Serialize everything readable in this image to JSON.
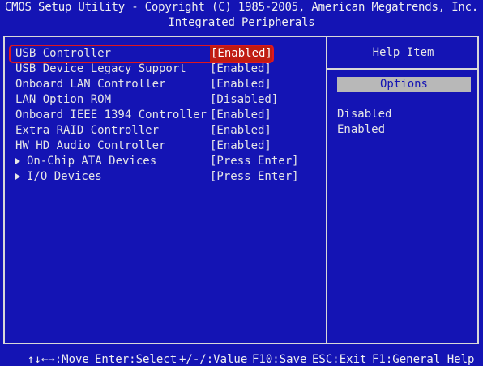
{
  "header": {
    "line1": "CMOS Setup Utility - Copyright (C) 1985-2005, American Megatrends, Inc.",
    "line2": "Integrated Peripherals"
  },
  "settings": [
    {
      "label": "USB Controller",
      "value": "[Enabled]",
      "selected": true
    },
    {
      "label": "USB Device Legacy Support",
      "value": "[Enabled]"
    },
    {
      "label": "Onboard LAN Controller",
      "value": "[Enabled]"
    },
    {
      "label": "LAN Option ROM",
      "value": "[Disabled]"
    },
    {
      "label": "Onboard IEEE 1394 Controller",
      "value": "[Enabled]"
    },
    {
      "label": "Extra RAID Controller",
      "value": "[Enabled]"
    },
    {
      "label": "HW HD Audio Controller",
      "value": "[Enabled]"
    },
    {
      "label": "On-Chip ATA Devices",
      "value": "[Press Enter]",
      "submenu": true
    },
    {
      "label": "I/O Devices",
      "value": "[Press Enter]",
      "submenu": true
    }
  ],
  "help": {
    "title": "Help Item",
    "options_header": "Options",
    "options": [
      "Disabled",
      "Enabled"
    ]
  },
  "footer": {
    "move": "↑↓←→:Move",
    "select": "Enter:Select",
    "value": "+/-/:Value",
    "save": "F10:Save",
    "exit": "ESC:Exit",
    "help": "F1:General Help"
  },
  "colors": {
    "background": "#1414b4",
    "selected_value_bg": "#c01c12",
    "highlight_border": "#e0171d",
    "options_header_bg": "#b8b8b8"
  }
}
